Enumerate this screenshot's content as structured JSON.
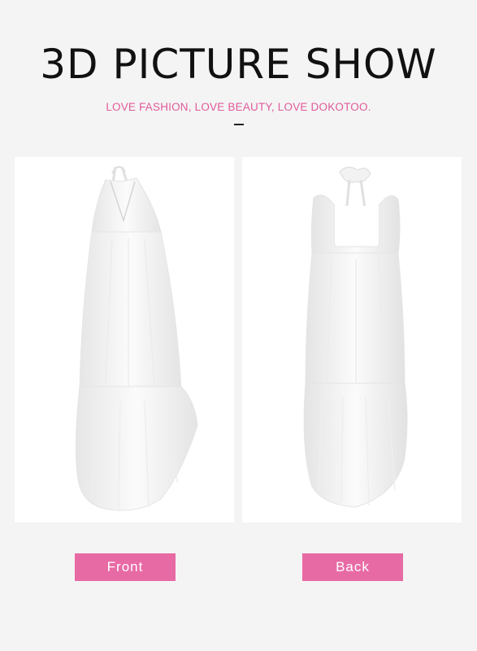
{
  "header": {
    "title": "3D PICTURE SHOW",
    "subtitle": "LOVE FASHION, LOVE BEAUTY, LOVE DOKOTOO."
  },
  "views": [
    {
      "label": "Front",
      "icon": "dress-front-view"
    },
    {
      "label": "Back",
      "icon": "dress-back-view"
    }
  ],
  "colors": {
    "accent": "#e86aa5",
    "subtitle": "#e05a9a",
    "background": "#f4f4f4",
    "panel": "#ffffff"
  }
}
